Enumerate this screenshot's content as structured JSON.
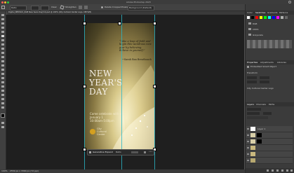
{
  "window": {
    "title": "Adobe Photoshop 2023"
  },
  "options_bar": {
    "ratio": "Ratio",
    "clear": "Clear",
    "straighten": "Straighten",
    "delete_cropped": "Delete Cropped Pixels",
    "fill": "Background (Default)"
  },
  "document": {
    "tab_label": "Digital_NEWSOC_RGB New Years Day(V4).psd @ 100% (City Cultural Center Logo, CMYK/8)"
  },
  "artwork": {
    "quote": "“Take a leap of faith and begin this wondrous new year by believing. Believe in yourself.”",
    "quote_author": "~Sarah Ban Breathnach",
    "headline": [
      "NEW",
      "YEAR'S",
      "DAY"
    ],
    "invite": "Come celebrate with us!",
    "date": "January 1",
    "time": "10:00am-5:00pm",
    "logo": [
      "City",
      "Cultural",
      "Center"
    ],
    "accent_color": "#d4a020"
  },
  "context_bar": {
    "label": "Generative Expand",
    "ratio": "Ratio"
  },
  "status_bar": {
    "zoom": "100%",
    "info": "2550 px x 3300 px (72 ppi)"
  },
  "right_panel": {
    "top_tabs": [
      "Color",
      "Swatches",
      "Gradients",
      "Patterns"
    ],
    "swatch_colors": [
      "#ffffff",
      "#000000",
      "#ff0000",
      "#ffff00",
      "#00ff00",
      "#00ffff",
      "#0000ff",
      "#ff00ff",
      "#b0b0b0",
      "#666666"
    ],
    "folders": [
      "RGB",
      "CMYK",
      "Grayscale"
    ],
    "props_tabs": [
      "Properties",
      "Adjustments",
      "Libraries"
    ],
    "props_item": "Embedded Smart Object",
    "transform_label": "Transform",
    "layer_comp": "City Cultural Center Logo",
    "layers_tabs": [
      "Layers",
      "Channels",
      "Paths"
    ],
    "layers": [
      {
        "name": "Layer 1"
      },
      {
        "name": ""
      },
      {
        "name": ""
      },
      {
        "name": ""
      },
      {
        "name": ""
      },
      {
        "name": ""
      }
    ]
  }
}
